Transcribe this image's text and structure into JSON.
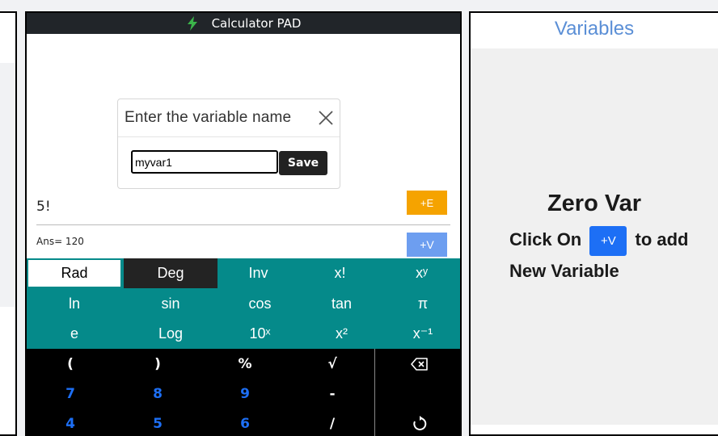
{
  "calculator": {
    "title": "Calculator PAD",
    "expression": "5!",
    "answer": "Ans= 120",
    "add_e_label": "+E",
    "add_v_label": "+V"
  },
  "modal": {
    "title": "Enter the variable name",
    "input_value": "myvar1",
    "save_label": "Save"
  },
  "keypad": {
    "teal_rows": [
      [
        "Rad",
        "Deg",
        "Inv",
        "x!",
        "xʸ"
      ],
      [
        "ln",
        "sin",
        "cos",
        "tan",
        "π"
      ],
      [
        "e",
        "Log",
        "10ˣ",
        "x²",
        "x⁻¹"
      ]
    ],
    "black_rows": [
      [
        "(",
        ")",
        "%",
        "√",
        "backspace-icon"
      ],
      [
        "7",
        "8",
        "9",
        "-",
        ""
      ],
      [
        "4",
        "5",
        "6",
        "/",
        "reset-icon"
      ]
    ]
  },
  "variables": {
    "title": "Variables",
    "empty_title": "Zero Var",
    "hint_prefix": "Click On",
    "hint_button": "+V",
    "hint_suffix": "to add New Variable"
  },
  "colors": {
    "teal": "#058a8a",
    "orange": "#f5a300",
    "blue": "#1d6ff5",
    "light_blue": "#6d9ef0"
  }
}
